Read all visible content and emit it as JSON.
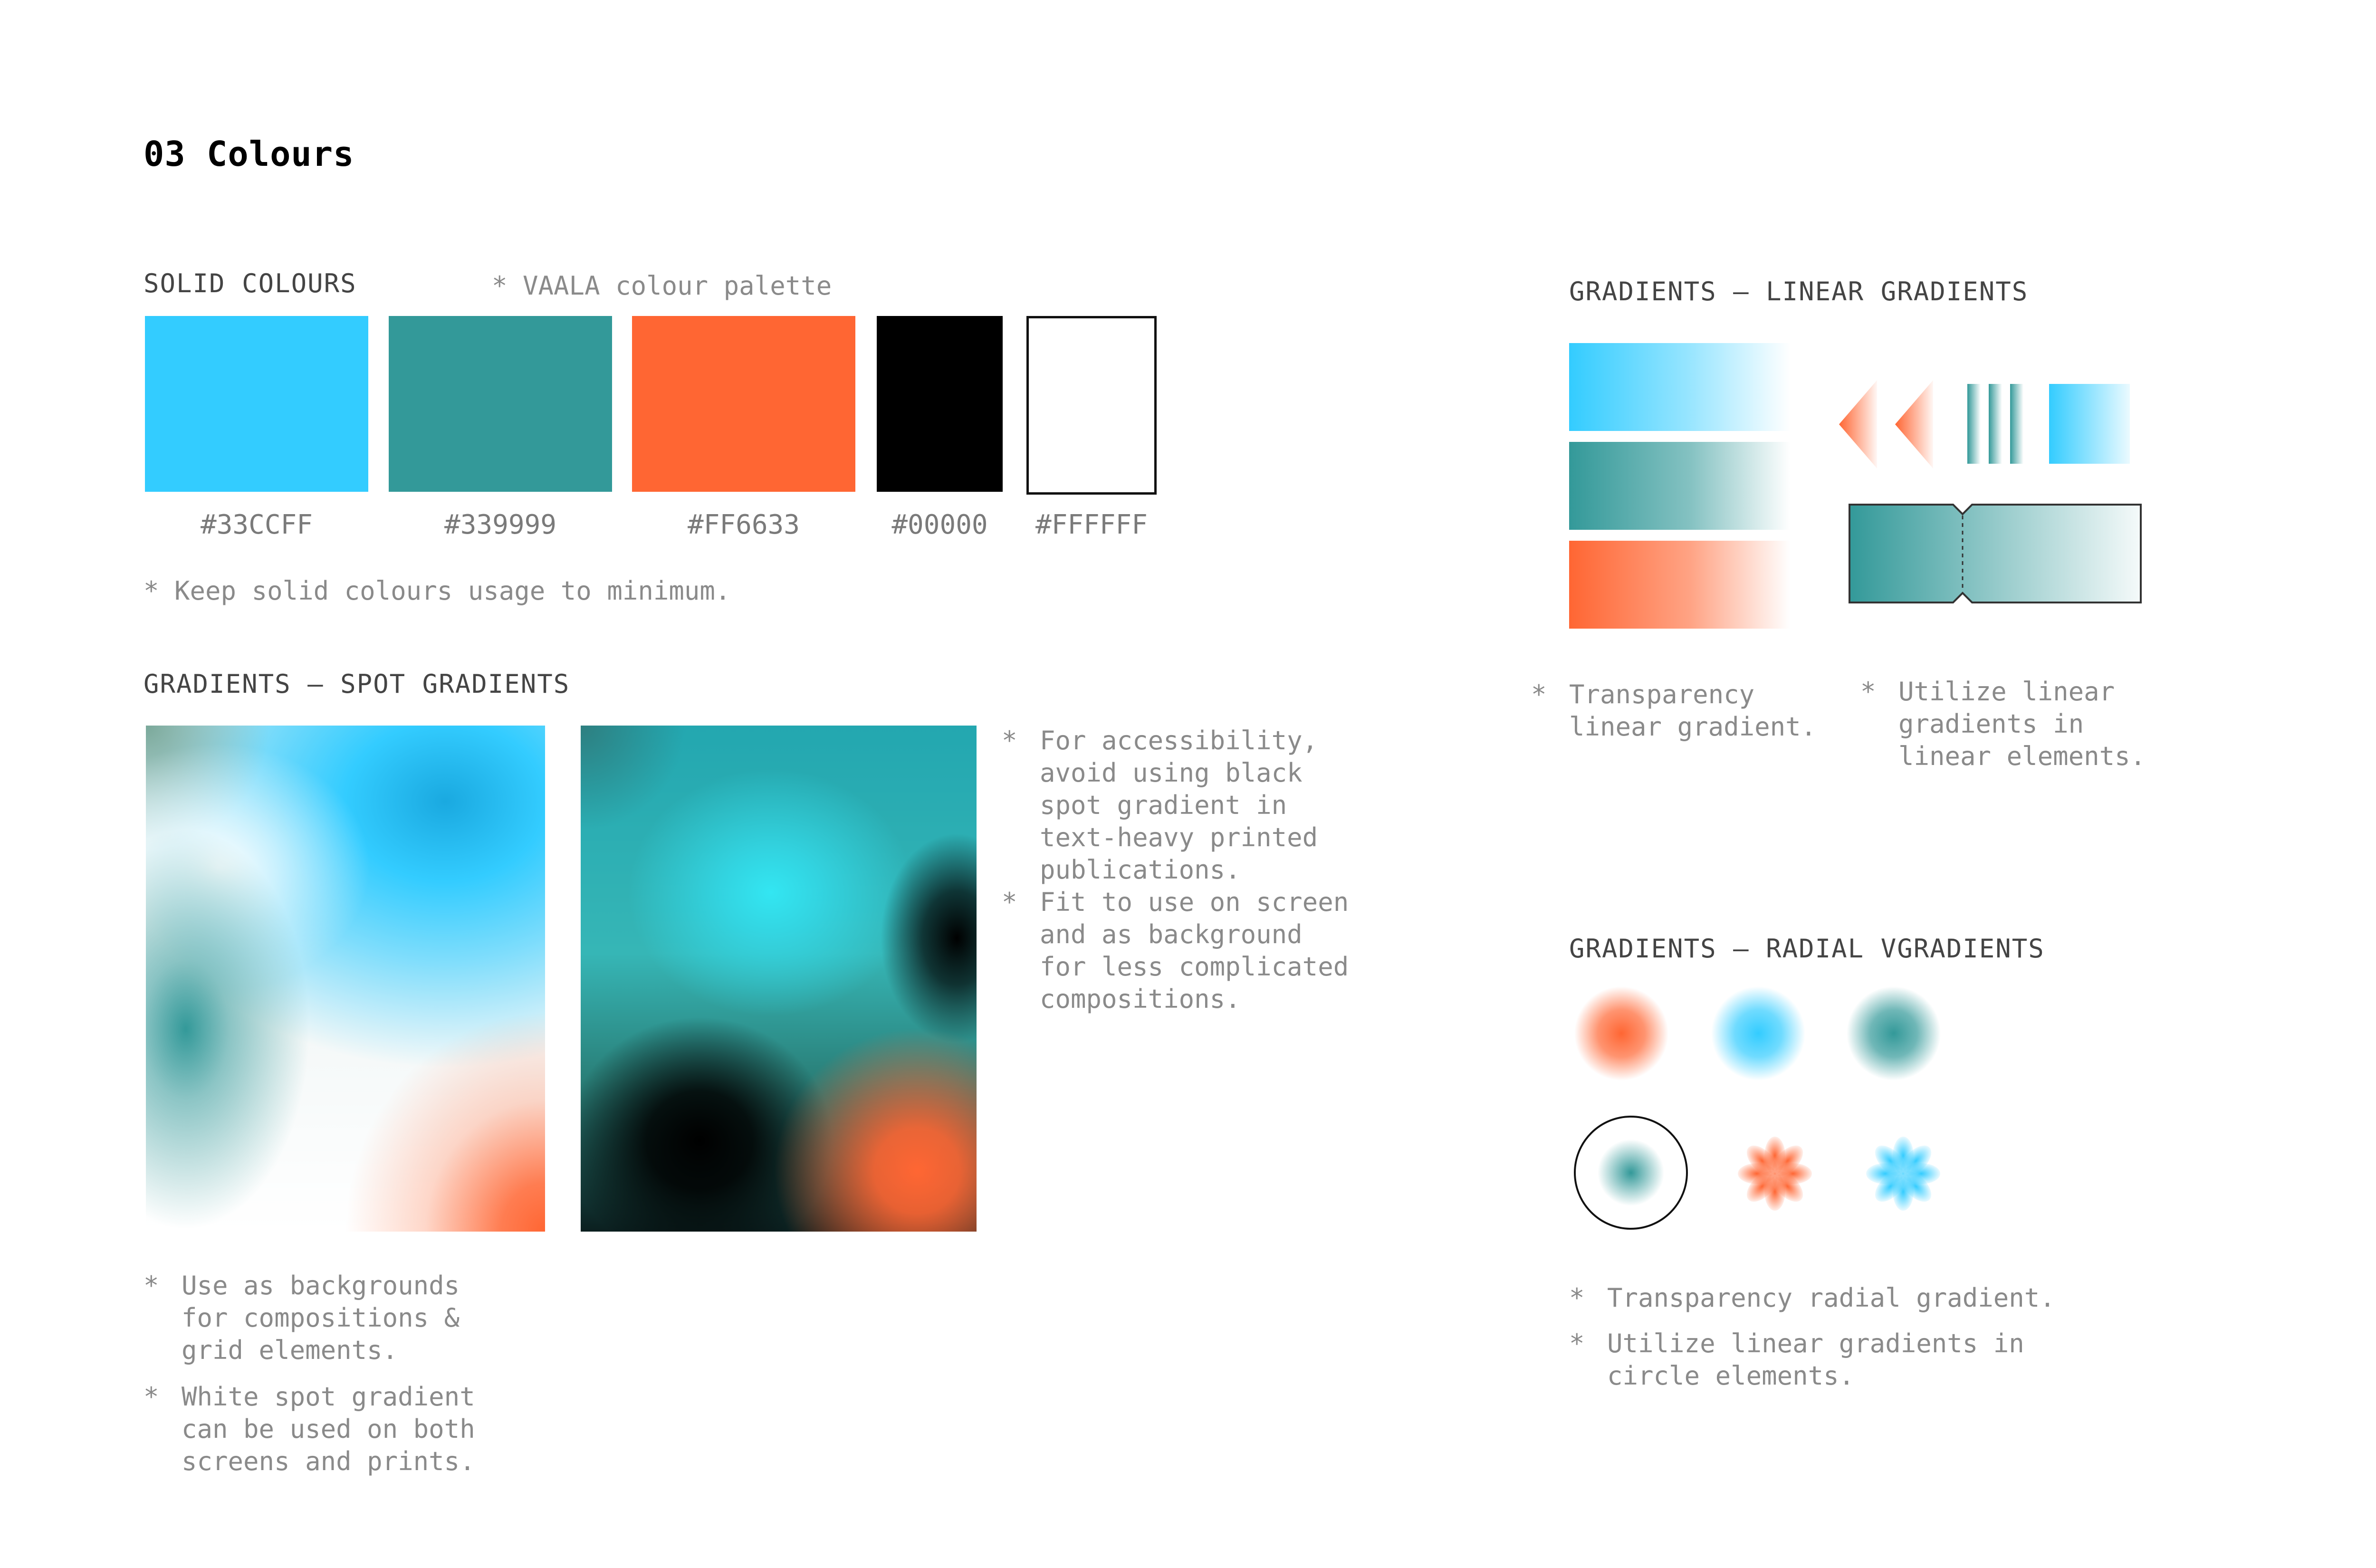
{
  "page": {
    "title": "03 Colours"
  },
  "solid": {
    "heading": "SOLID COLOURS",
    "palette_note": "* VAALA colour palette",
    "swatches": [
      {
        "hex": "#33CCFF",
        "color": "#33CCFF"
      },
      {
        "hex": "#339999",
        "color": "#339999"
      },
      {
        "hex": "#FF6633",
        "color": "#FF6633"
      },
      {
        "hex": "#00000",
        "color": "#000000"
      },
      {
        "hex": "#FFFFFF",
        "color": "#FFFFFF"
      }
    ],
    "usage_note": "* Keep solid colours usage to minimum."
  },
  "spot": {
    "heading": "GRADIENTS — SPOT GRADIENTS",
    "side_notes": [
      [
        "For accessibility,",
        "avoid using black",
        "spot gradient in",
        "text-heavy printed",
        "publications."
      ],
      [
        "Fit to use on screen",
        "and as background",
        "for less complicated",
        "compositions."
      ]
    ],
    "bottom_notes": [
      [
        "Use as backgrounds",
        "for compositions &",
        "grid elements."
      ],
      [
        "White spot gradient",
        "can be used on both",
        "screens and prints."
      ]
    ]
  },
  "linear": {
    "heading": "GRADIENTS — LINEAR GRADIENTS",
    "notes": [
      [
        "Transparency",
        "linear gradient."
      ],
      [
        "Utilize linear",
        "gradients in",
        "linear elements."
      ]
    ]
  },
  "radial": {
    "heading": "GRADIENTS — RADIAL VGRADIENTS",
    "notes": [
      [
        "Transparency radial gradient."
      ],
      [
        "Utilize linear gradients in",
        "circle elements."
      ]
    ]
  },
  "note_marker": "*",
  "colors": {
    "cyan": "#33CCFF",
    "teal": "#339999",
    "orange": "#FF6633",
    "black": "#000000",
    "white": "#FFFFFF",
    "text": "#8A8A8A",
    "heading": "#444444"
  }
}
